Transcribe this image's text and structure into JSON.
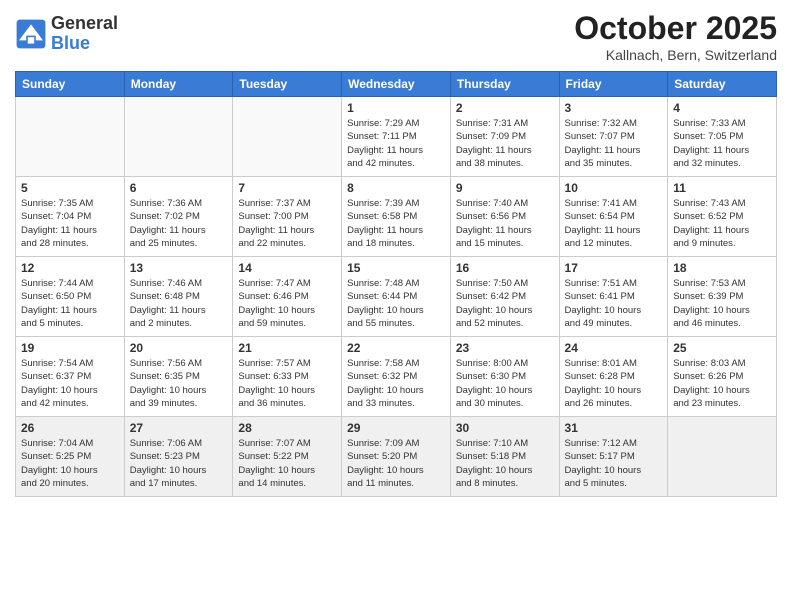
{
  "header": {
    "logo_general": "General",
    "logo_blue": "Blue",
    "month_title": "October 2025",
    "location": "Kallnach, Bern, Switzerland"
  },
  "weekdays": [
    "Sunday",
    "Monday",
    "Tuesday",
    "Wednesday",
    "Thursday",
    "Friday",
    "Saturday"
  ],
  "weeks": [
    [
      {
        "day": "",
        "info": ""
      },
      {
        "day": "",
        "info": ""
      },
      {
        "day": "",
        "info": ""
      },
      {
        "day": "1",
        "info": "Sunrise: 7:29 AM\nSunset: 7:11 PM\nDaylight: 11 hours\nand 42 minutes."
      },
      {
        "day": "2",
        "info": "Sunrise: 7:31 AM\nSunset: 7:09 PM\nDaylight: 11 hours\nand 38 minutes."
      },
      {
        "day": "3",
        "info": "Sunrise: 7:32 AM\nSunset: 7:07 PM\nDaylight: 11 hours\nand 35 minutes."
      },
      {
        "day": "4",
        "info": "Sunrise: 7:33 AM\nSunset: 7:05 PM\nDaylight: 11 hours\nand 32 minutes."
      }
    ],
    [
      {
        "day": "5",
        "info": "Sunrise: 7:35 AM\nSunset: 7:04 PM\nDaylight: 11 hours\nand 28 minutes."
      },
      {
        "day": "6",
        "info": "Sunrise: 7:36 AM\nSunset: 7:02 PM\nDaylight: 11 hours\nand 25 minutes."
      },
      {
        "day": "7",
        "info": "Sunrise: 7:37 AM\nSunset: 7:00 PM\nDaylight: 11 hours\nand 22 minutes."
      },
      {
        "day": "8",
        "info": "Sunrise: 7:39 AM\nSunset: 6:58 PM\nDaylight: 11 hours\nand 18 minutes."
      },
      {
        "day": "9",
        "info": "Sunrise: 7:40 AM\nSunset: 6:56 PM\nDaylight: 11 hours\nand 15 minutes."
      },
      {
        "day": "10",
        "info": "Sunrise: 7:41 AM\nSunset: 6:54 PM\nDaylight: 11 hours\nand 12 minutes."
      },
      {
        "day": "11",
        "info": "Sunrise: 7:43 AM\nSunset: 6:52 PM\nDaylight: 11 hours\nand 9 minutes."
      }
    ],
    [
      {
        "day": "12",
        "info": "Sunrise: 7:44 AM\nSunset: 6:50 PM\nDaylight: 11 hours\nand 5 minutes."
      },
      {
        "day": "13",
        "info": "Sunrise: 7:46 AM\nSunset: 6:48 PM\nDaylight: 11 hours\nand 2 minutes."
      },
      {
        "day": "14",
        "info": "Sunrise: 7:47 AM\nSunset: 6:46 PM\nDaylight: 10 hours\nand 59 minutes."
      },
      {
        "day": "15",
        "info": "Sunrise: 7:48 AM\nSunset: 6:44 PM\nDaylight: 10 hours\nand 55 minutes."
      },
      {
        "day": "16",
        "info": "Sunrise: 7:50 AM\nSunset: 6:42 PM\nDaylight: 10 hours\nand 52 minutes."
      },
      {
        "day": "17",
        "info": "Sunrise: 7:51 AM\nSunset: 6:41 PM\nDaylight: 10 hours\nand 49 minutes."
      },
      {
        "day": "18",
        "info": "Sunrise: 7:53 AM\nSunset: 6:39 PM\nDaylight: 10 hours\nand 46 minutes."
      }
    ],
    [
      {
        "day": "19",
        "info": "Sunrise: 7:54 AM\nSunset: 6:37 PM\nDaylight: 10 hours\nand 42 minutes."
      },
      {
        "day": "20",
        "info": "Sunrise: 7:56 AM\nSunset: 6:35 PM\nDaylight: 10 hours\nand 39 minutes."
      },
      {
        "day": "21",
        "info": "Sunrise: 7:57 AM\nSunset: 6:33 PM\nDaylight: 10 hours\nand 36 minutes."
      },
      {
        "day": "22",
        "info": "Sunrise: 7:58 AM\nSunset: 6:32 PM\nDaylight: 10 hours\nand 33 minutes."
      },
      {
        "day": "23",
        "info": "Sunrise: 8:00 AM\nSunset: 6:30 PM\nDaylight: 10 hours\nand 30 minutes."
      },
      {
        "day": "24",
        "info": "Sunrise: 8:01 AM\nSunset: 6:28 PM\nDaylight: 10 hours\nand 26 minutes."
      },
      {
        "day": "25",
        "info": "Sunrise: 8:03 AM\nSunset: 6:26 PM\nDaylight: 10 hours\nand 23 minutes."
      }
    ],
    [
      {
        "day": "26",
        "info": "Sunrise: 7:04 AM\nSunset: 5:25 PM\nDaylight: 10 hours\nand 20 minutes."
      },
      {
        "day": "27",
        "info": "Sunrise: 7:06 AM\nSunset: 5:23 PM\nDaylight: 10 hours\nand 17 minutes."
      },
      {
        "day": "28",
        "info": "Sunrise: 7:07 AM\nSunset: 5:22 PM\nDaylight: 10 hours\nand 14 minutes."
      },
      {
        "day": "29",
        "info": "Sunrise: 7:09 AM\nSunset: 5:20 PM\nDaylight: 10 hours\nand 11 minutes."
      },
      {
        "day": "30",
        "info": "Sunrise: 7:10 AM\nSunset: 5:18 PM\nDaylight: 10 hours\nand 8 minutes."
      },
      {
        "day": "31",
        "info": "Sunrise: 7:12 AM\nSunset: 5:17 PM\nDaylight: 10 hours\nand 5 minutes."
      },
      {
        "day": "",
        "info": ""
      }
    ]
  ]
}
